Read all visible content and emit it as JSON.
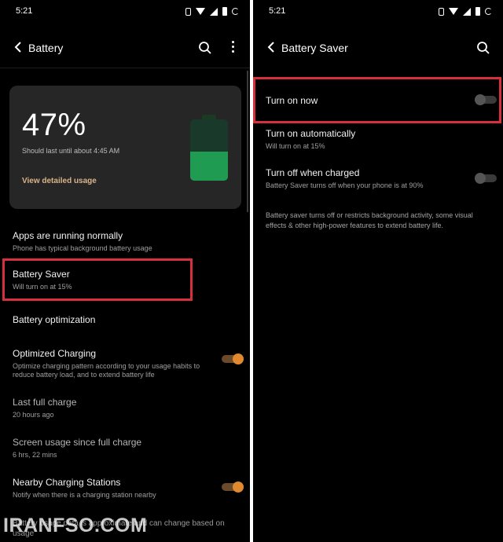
{
  "left": {
    "status": {
      "time": "5:21"
    },
    "appbar": {
      "title": "Battery",
      "back_icon": "arrow-left-icon",
      "search_icon": "search-icon",
      "menu_icon": "more-vert-icon"
    },
    "card": {
      "percent_text": "47%",
      "level": 0.47,
      "subtitle": "Should last until about 4:45 AM",
      "link": "View detailed usage",
      "fill_color": "#1f9c52"
    },
    "items": [
      {
        "title": "Apps are running normally",
        "subtitle": "Phone has typical background battery usage"
      },
      {
        "title": "Battery Saver",
        "subtitle": "Will turn on at 15%"
      },
      {
        "title": "Battery optimization",
        "subtitle": ""
      },
      {
        "title": "Optimized Charging",
        "subtitle": "Optimize charging pattern according to your usage habits to reduce battery load, and to extend battery life",
        "toggle": "on"
      },
      {
        "title": "Last full charge",
        "subtitle": "20 hours ago"
      },
      {
        "title": "Screen usage since full charge",
        "subtitle": "6 hrs, 22 mins"
      },
      {
        "title": "Nearby Charging Stations",
        "subtitle": "Notify when there is a charging station nearby",
        "toggle": "on"
      }
    ],
    "footer": "Battery usage data is approximate and can change based on usage",
    "watermark": "IRANFSO.COM"
  },
  "right": {
    "status": {
      "time": "5:21"
    },
    "appbar": {
      "title": "Battery Saver",
      "back_icon": "arrow-left-icon",
      "search_icon": "search-icon"
    },
    "items": [
      {
        "title": "Turn on now",
        "subtitle": "",
        "toggle": "off"
      },
      {
        "title": "Turn on automatically",
        "subtitle": "Will turn on at 15%"
      },
      {
        "title": "Turn off when charged",
        "subtitle": "Battery Saver turns off when your phone is at 90%",
        "toggle": "off"
      }
    ],
    "description": "Battery saver turns off or restricts background activity, some visual effects & other high-power features to extend battery life."
  },
  "colors": {
    "accent": "#e0892f",
    "highlight": "#d6303f",
    "link": "#d9b48a"
  }
}
